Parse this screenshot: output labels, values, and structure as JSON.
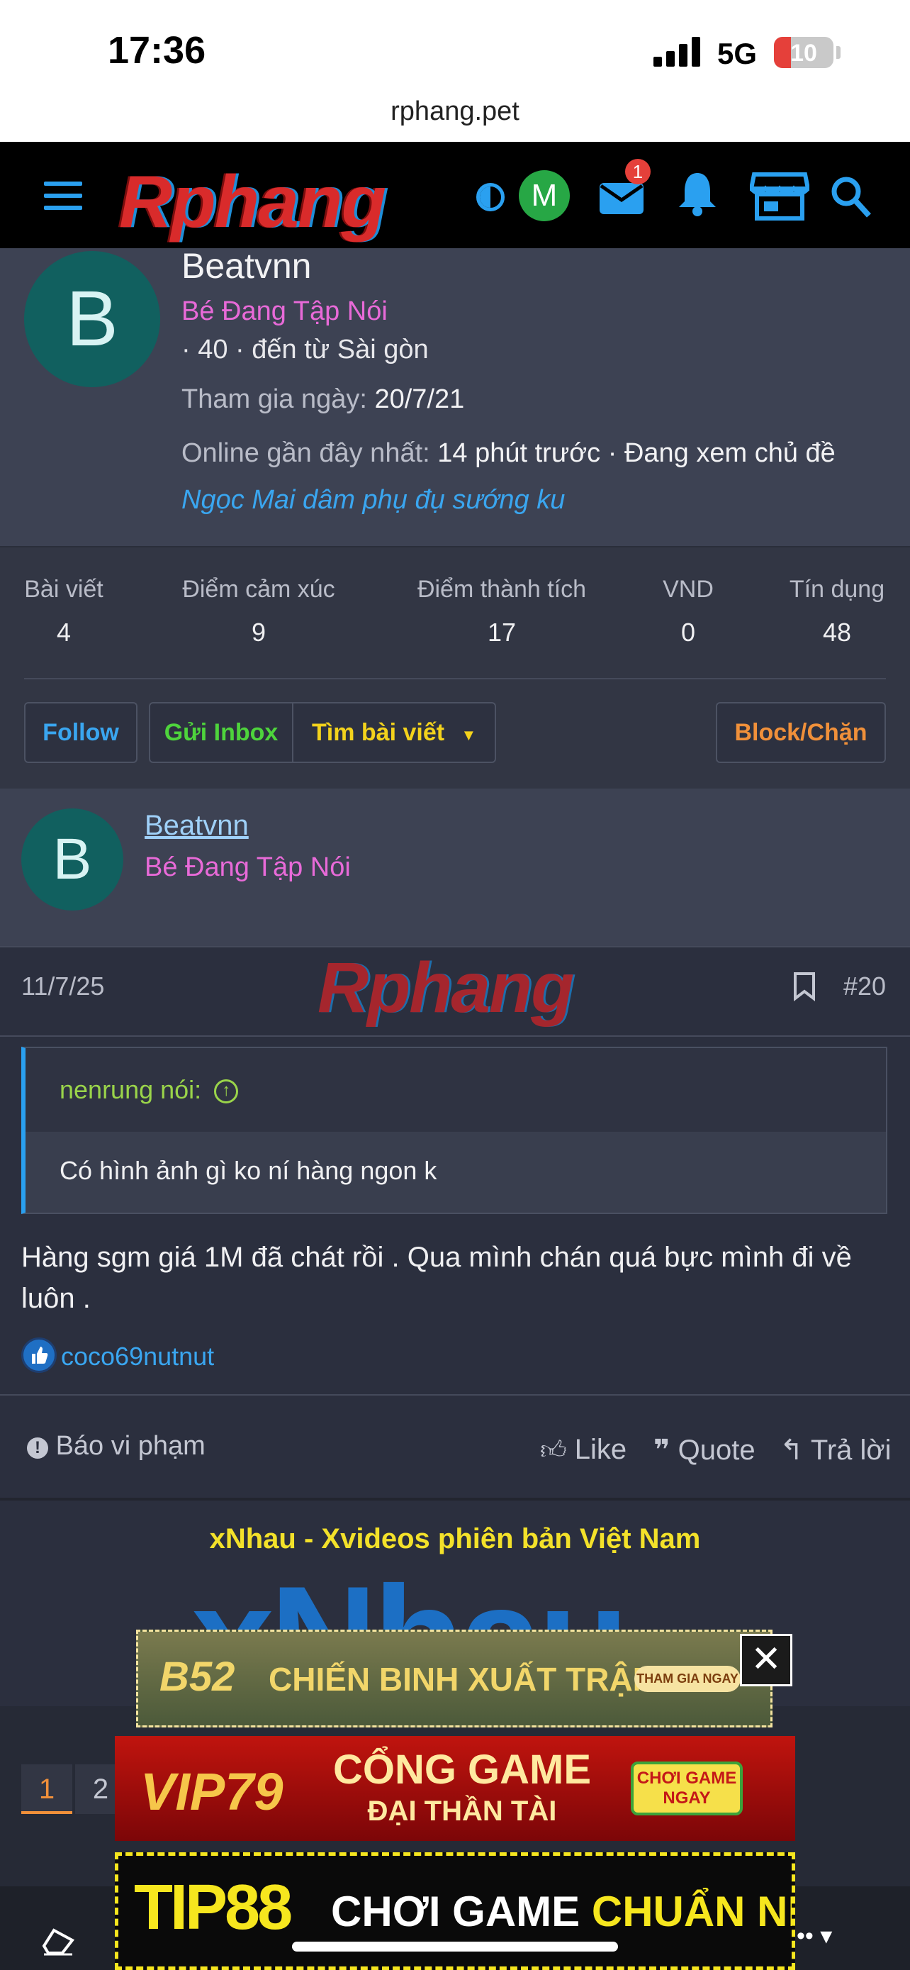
{
  "status_bar": {
    "time": "17:36",
    "network": "5G",
    "battery": "10",
    "url": "rphang.pet"
  },
  "nav": {
    "logo_text": "Rphang",
    "avatar_letter": "M",
    "inbox_badge": "1"
  },
  "profile": {
    "avatar_letter": "B",
    "name": "Beatvnn",
    "title": "Bé Đang Tập Nói",
    "meta": "· 40 · đến từ Sài gòn",
    "joined_label": "Tham gia ngày:",
    "joined_value": "20/7/21",
    "online_label": "Online gần đây nhất:",
    "online_value": "14 phút trước · Đang xem chủ đề",
    "viewing_thread": "Ngọc Mai dâm phụ đụ sướng ku",
    "stats": [
      {
        "label": "Bài viết",
        "value": "4"
      },
      {
        "label": "Điểm cảm xúc",
        "value": "9"
      },
      {
        "label": "Điểm thành tích",
        "value": "17"
      },
      {
        "label": "VND",
        "value": "0"
      },
      {
        "label": "Tín dụng",
        "value": "48"
      }
    ],
    "buttons": {
      "follow": "Follow",
      "inbox": "Gửi Inbox",
      "find_posts": "Tìm bài viết",
      "block": "Block/Chặn"
    }
  },
  "post": {
    "avatar_letter": "B",
    "username": "Beatvnn",
    "user_title": "Bé Đang Tập Nói",
    "date": "11/7/25",
    "watermark": "Rphang",
    "number": "#20",
    "quote_author": "nenrung nói:",
    "quote_text": "Có hình ảnh gì ko ní hàng ngon k",
    "message": "Hàng sgm giá 1M đã chát rồi . Qua mình chán quá bực mình đi về luôn .",
    "liked_by": "coco69nutnut",
    "actions": {
      "report": "Báo vi phạm",
      "like": "Like",
      "quote": "Quote",
      "reply": "Trả lời"
    }
  },
  "ad": {
    "title": "xNhau - Xvideos phiên bản Việt Nam",
    "big_text": "xNhau",
    "banner1": {
      "brand": "B52",
      "text": "CHIẾN BINH XUẤT TRẬN",
      "cta": "THAM GIA NGAY"
    },
    "banner2": {
      "brand": "VIP79",
      "line1": "CỔNG GAME",
      "line2": "ĐẠI THẦN TÀI",
      "cta": "CHƠI GAME NGAY"
    },
    "banner3": {
      "brand": "TIP88",
      "text1": "CHƠI GAME ",
      "text2": "CHUẨN NHÀ CÁI"
    }
  },
  "pager": {
    "pages": [
      "1",
      "2"
    ],
    "current": "1"
  },
  "colors": {
    "accent": "#2aa0f0",
    "title_pink": "#e86ad8",
    "follow_blue": "#3aa6f0",
    "inbox_green": "#4ed43c",
    "find_yellow": "#f3d21c",
    "block_orange": "#f0903a"
  }
}
